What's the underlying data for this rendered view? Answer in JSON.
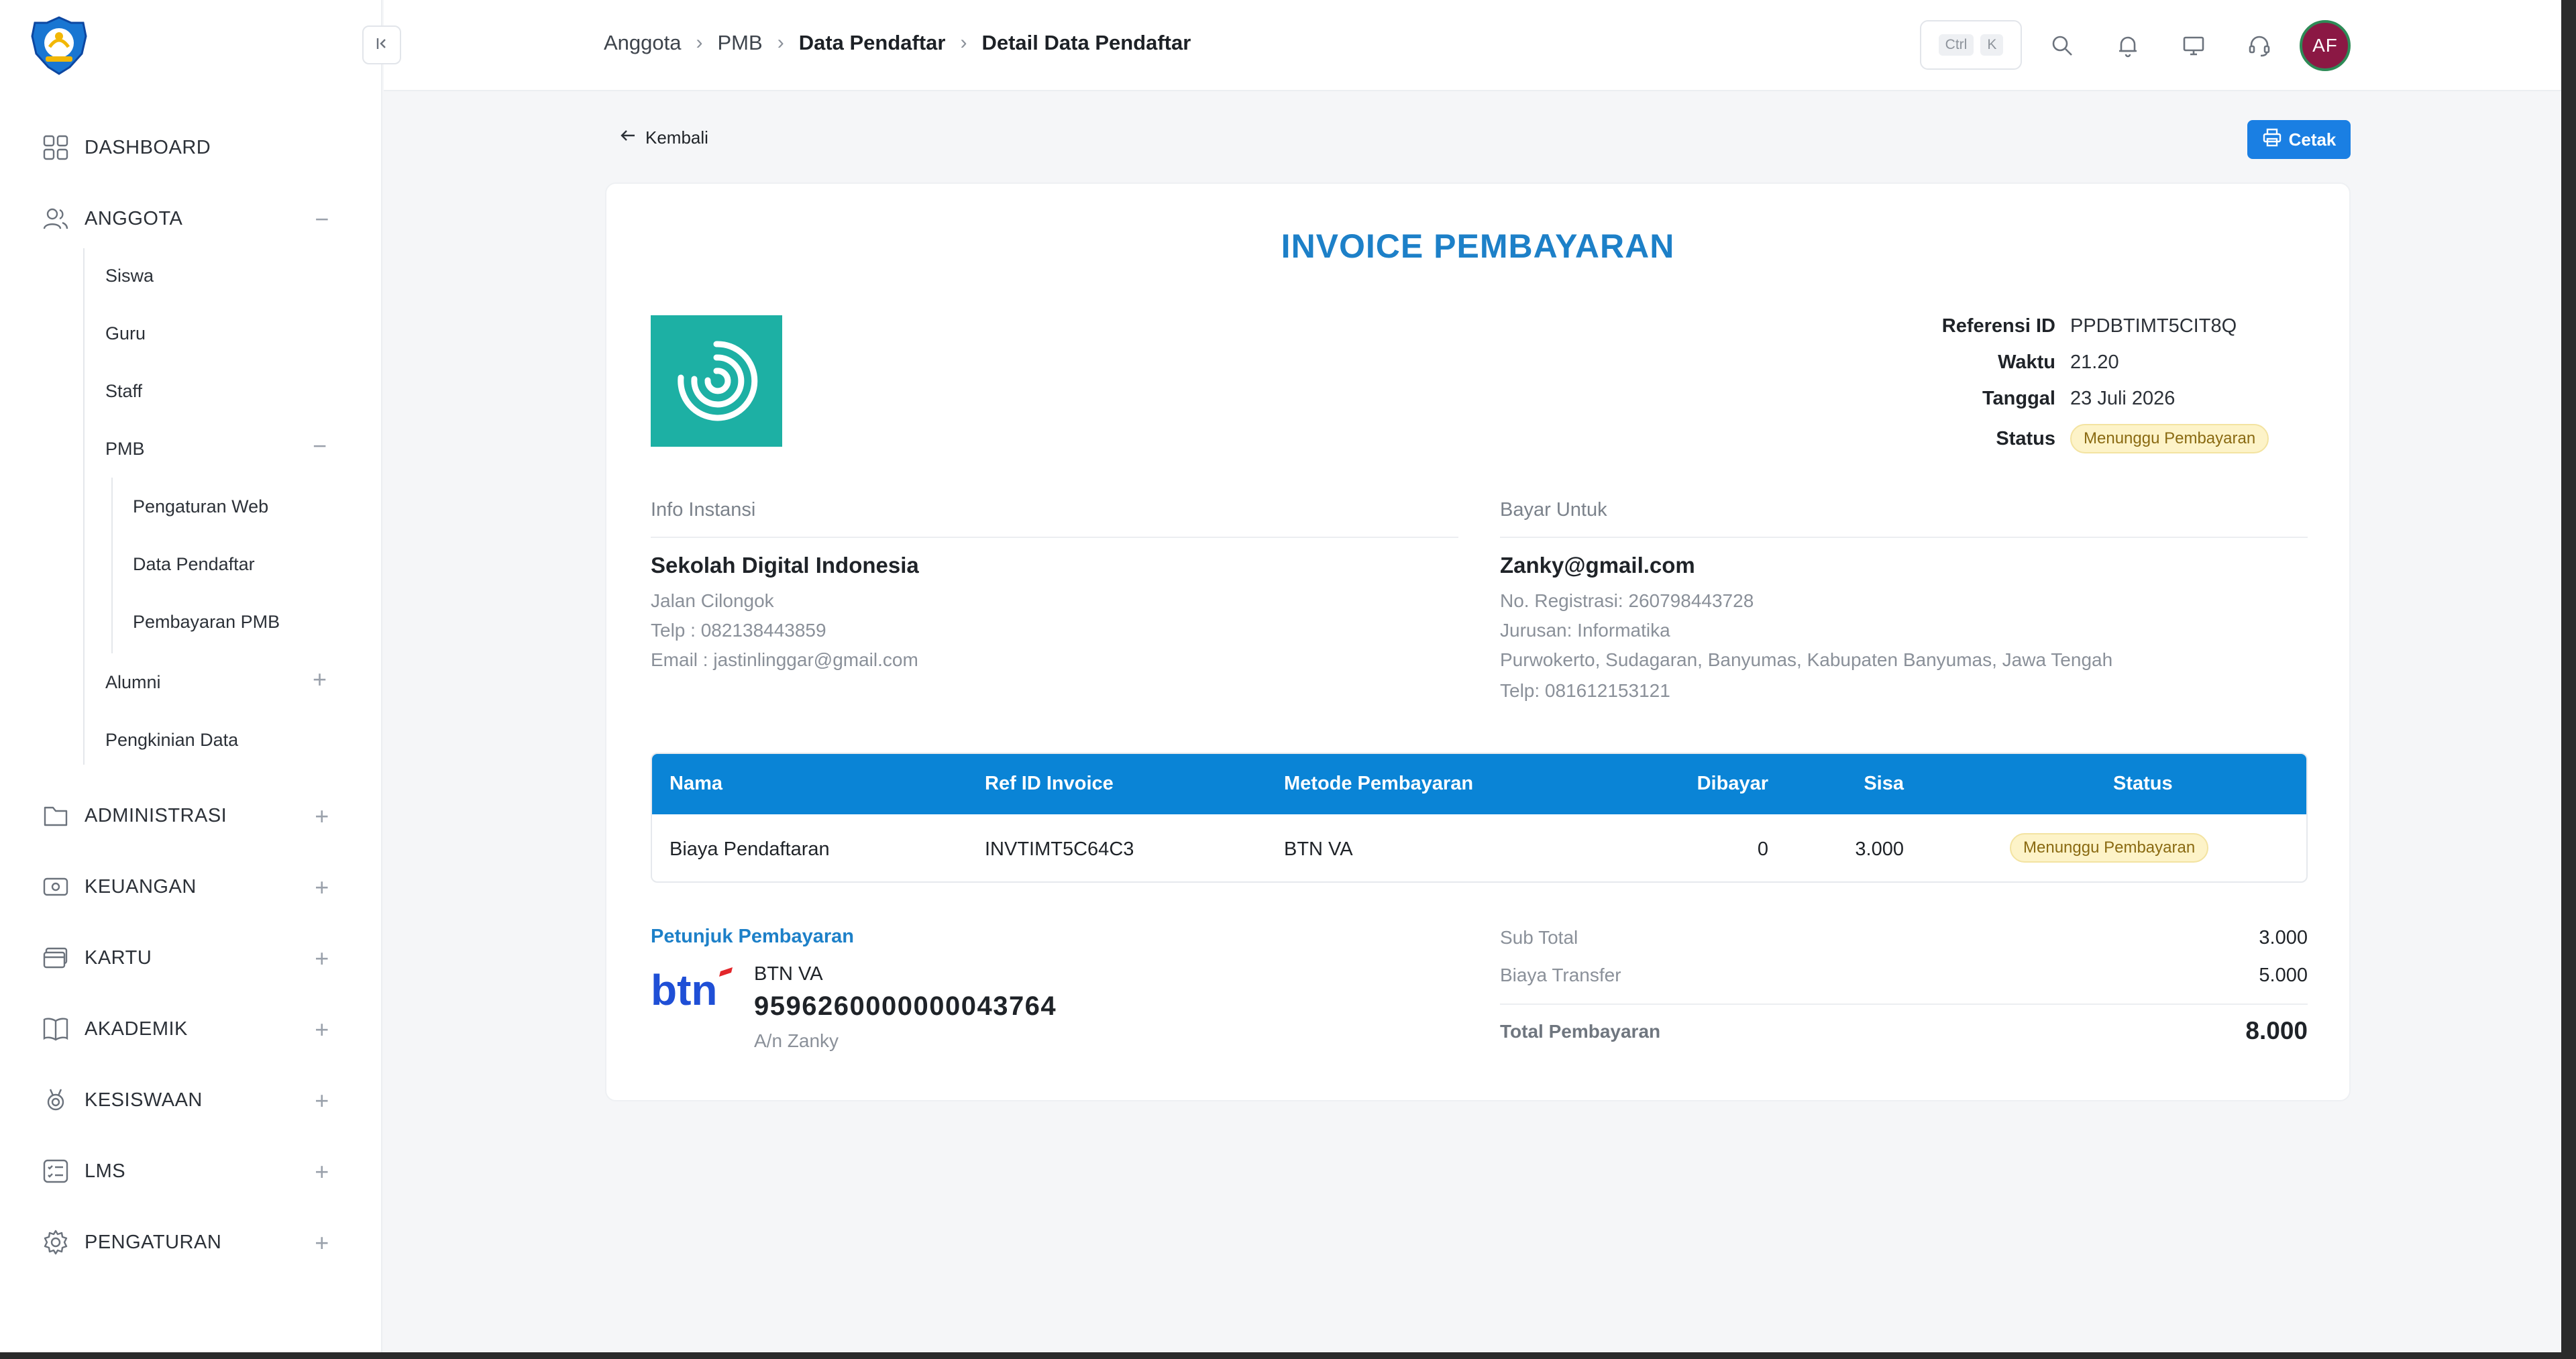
{
  "sidebar": {
    "items": [
      {
        "label": "DASHBOARD",
        "icon": "dashboard-grid-icon"
      },
      {
        "label": "ANGGOTA",
        "icon": "users-icon",
        "toggle": "−"
      },
      {
        "label": "ADMINISTRASI",
        "icon": "folder-icon",
        "toggle": "+"
      },
      {
        "label": "KEUANGAN",
        "icon": "money-icon",
        "toggle": "+"
      },
      {
        "label": "KARTU",
        "icon": "card-icon",
        "toggle": "+"
      },
      {
        "label": "AKADEMIK",
        "icon": "book-icon",
        "toggle": "+"
      },
      {
        "label": "KESISWAAN",
        "icon": "medal-icon",
        "toggle": "+"
      },
      {
        "label": "LMS",
        "icon": "list-icon",
        "toggle": "+"
      },
      {
        "label": "PENGATURAN",
        "icon": "gear-icon",
        "toggle": "+"
      }
    ],
    "anggota_sub": [
      "Siswa",
      "Guru",
      "Staff",
      "PMB",
      "Alumni",
      "Pengkinian Data"
    ],
    "pmb_sub": [
      "Pengaturan Web",
      "Data Pendaftar",
      "Pembayaran PMB"
    ],
    "pmb_toggle": "−",
    "alumni_toggle": "+"
  },
  "topbar": {
    "breadcrumb": [
      "Anggota",
      "PMB",
      "Data Pendaftar",
      "Detail Data Pendaftar"
    ],
    "shortcut_keys": [
      "Ctrl",
      "K"
    ],
    "avatar_initials": "AF"
  },
  "page": {
    "back_label": "Kembali",
    "print_label": "Cetak"
  },
  "invoice": {
    "title": "INVOICE PEMBAYARAN",
    "meta": {
      "ref_label": "Referensi ID",
      "ref_value": "PPDBTIMT5CIT8Q",
      "time_label": "Waktu",
      "time_value": "21.20",
      "date_label": "Tanggal",
      "date_value": "23 Juli 2026",
      "status_label": "Status",
      "status_value": "Menunggu Pembayaran"
    },
    "institution": {
      "heading": "Info Instansi",
      "name": "Sekolah Digital Indonesia",
      "address": "Jalan Cilongok",
      "phone": "Telp : 082138443859",
      "email": "Email : jastinlinggar@gmail.com"
    },
    "bill_to": {
      "heading": "Bayar Untuk",
      "email": "Zanky@gmail.com",
      "reg": "No. Registrasi: 260798443728",
      "major": "Jurusan: Informatika",
      "address": "Purwokerto, Sudagaran, Banyumas, Kabupaten Banyumas, Jawa Tengah",
      "phone": "Telp: 081612153121"
    },
    "table": {
      "headers": [
        "Nama",
        "Ref ID Invoice",
        "Metode Pembayaran",
        "Dibayar",
        "Sisa",
        "Status"
      ],
      "rows": [
        {
          "nama": "Biaya Pendaftaran",
          "ref": "INVTIMT5C64C3",
          "metode": "BTN VA",
          "dibayar": "0",
          "sisa": "3.000",
          "status": "Menunggu Pembayaran"
        }
      ]
    },
    "payment": {
      "heading": "Petunjuk Pembayaran",
      "bank_logo_text": "btn",
      "va_name": "BTN VA",
      "va_number": "9596260000000043764",
      "account_name": "A/n Zanky"
    },
    "summary": {
      "subtotal_label": "Sub Total",
      "subtotal_value": "3.000",
      "fee_label": "Biaya Transfer",
      "fee_value": "5.000",
      "total_label": "Total Pembayaran",
      "total_value": "8.000"
    }
  },
  "colors": {
    "accent": "#1a7fe3",
    "title_blue": "#1d80c8",
    "table_header": "#0a84d6",
    "badge_bg": "#fdf3c8",
    "inst_logo_bg": "#1db0a4",
    "avatar_bg": "#8b1844",
    "btn_blue": "#1f4fd6",
    "btn_red": "#e3262b"
  }
}
